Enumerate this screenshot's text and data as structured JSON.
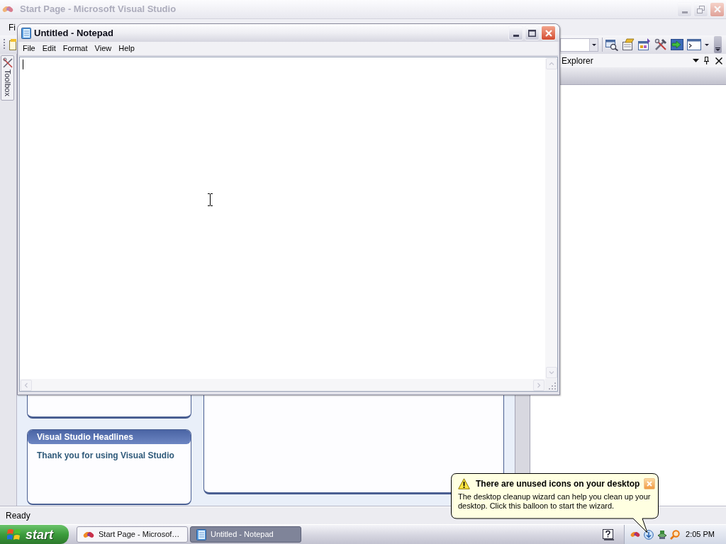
{
  "vs_window": {
    "title": "Start Page - Microsoft Visual Studio",
    "active": false,
    "menu": [
      "Fi"
    ],
    "toolbox_tab": {
      "label": "Toolbox"
    },
    "solution_explorer": {
      "title": "Explorer"
    },
    "start_page": {
      "headlines": {
        "title": "Visual Studio Headlines",
        "text": "Thank you for using Visual Studio"
      }
    },
    "status_bar": {
      "text": "Ready"
    }
  },
  "notepad": {
    "title": "Untitled - Notepad",
    "active": true,
    "menu": [
      "File",
      "Edit",
      "Format",
      "View",
      "Help"
    ]
  },
  "balloon": {
    "title": "There are unused icons on your desktop",
    "text": "The desktop cleanup wizard can help you clean up your desktop. Click this balloon to start the wizard."
  },
  "taskbar": {
    "start_label": "start",
    "tasks": [
      {
        "label": "Start Page - Microsof…",
        "selected": false
      },
      {
        "label": "Untitled - Notepad",
        "selected": true
      }
    ],
    "clock": "2:05 PM"
  }
}
